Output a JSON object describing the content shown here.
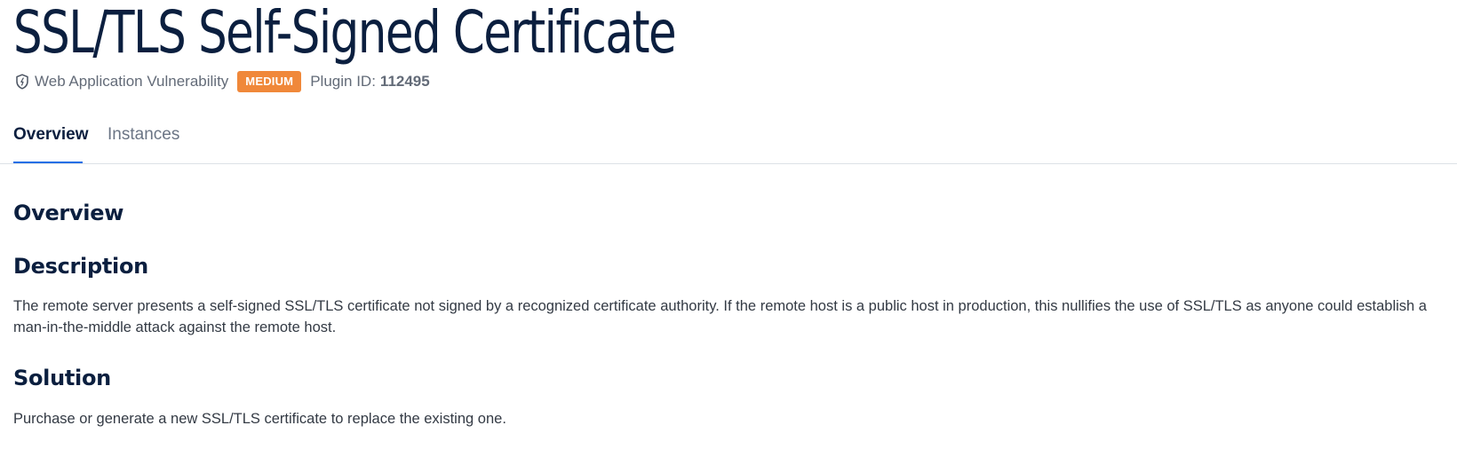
{
  "page": {
    "title": "SSL/TLS Self-Signed Certificate"
  },
  "meta": {
    "category_icon": "shield-icon",
    "category": "Web Application Vulnerability",
    "severity": "MEDIUM",
    "severity_color": "#f0883a",
    "plugin_label": "Plugin ID:",
    "plugin_id": "112495"
  },
  "tabs": [
    {
      "label": "Overview",
      "active": true
    },
    {
      "label": "Instances",
      "active": false
    }
  ],
  "content": {
    "overview_heading": "Overview",
    "description_heading": "Description",
    "description_text": "The remote server presents a self-signed SSL/TLS certificate not signed by a recognized certificate authority. If the remote host is a public host in production, this nullifies the use of SSL/TLS as anyone could establish a man-in-the-middle attack against the remote host.",
    "solution_heading": "Solution",
    "solution_text": "Purchase or generate a new SSL/TLS certificate to replace the existing one."
  },
  "colors": {
    "title": "#0b1f3f",
    "active_tab_underline": "#1f6fe5",
    "muted_text": "#636b78"
  }
}
